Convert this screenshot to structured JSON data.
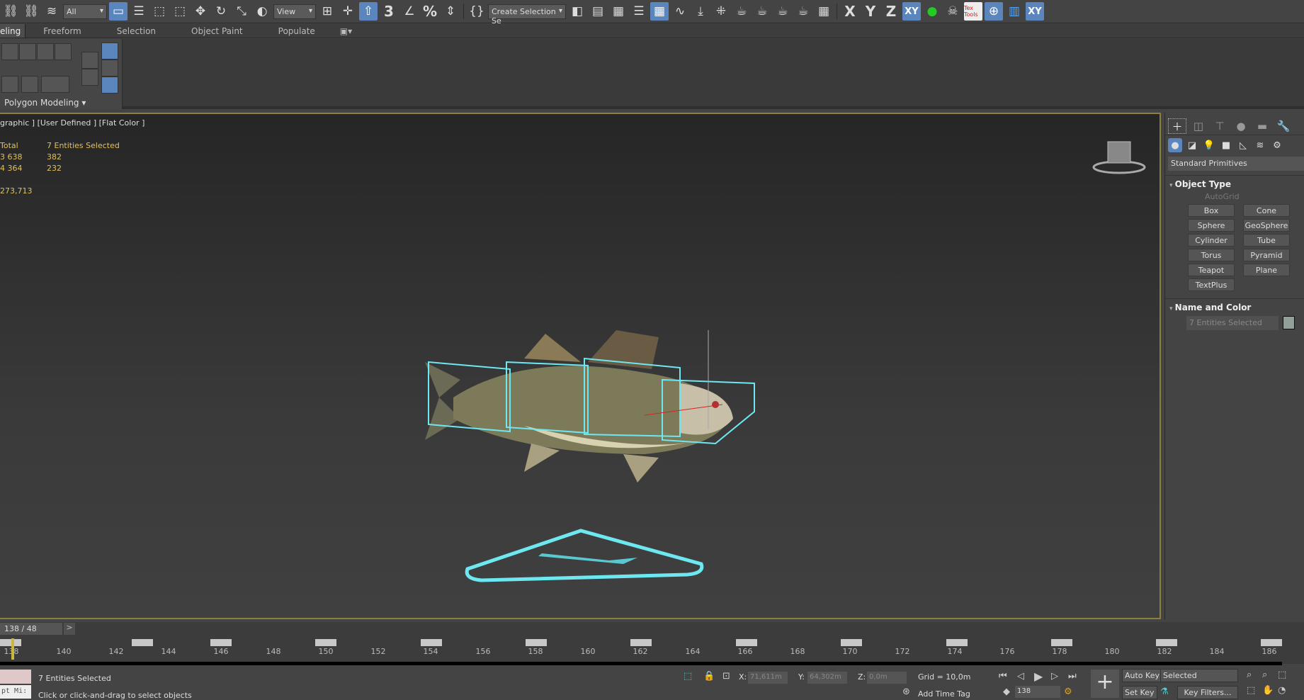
{
  "toolbar": {
    "selection_filter": "All",
    "ref_coord": "View",
    "named_selection": "Create Selection Se",
    "axis_x": "X",
    "axis_y": "Y",
    "axis_z": "Z",
    "axis_xy": "XY",
    "tex_tools": "Tex Tools",
    "xy_mod": "XY"
  },
  "ribbon": {
    "tabs": [
      "eling",
      "Freeform",
      "Selection",
      "Object Paint",
      "Populate"
    ],
    "panel_label": "Polygon Modeling"
  },
  "viewport": {
    "label": "graphic ] [User Defined ] [Flat Color ]",
    "stats": {
      "col1": [
        "Total",
        "3 638",
        "4 364",
        "",
        "273,713"
      ],
      "col2": [
        "7 Entities Selected",
        "382",
        "232"
      ]
    },
    "accent": "#8f7f3f",
    "selection_color": "#6ee8f0"
  },
  "command_panel": {
    "category": "Standard Primitives",
    "object_type_title": "Object Type",
    "autogrid": "AutoGrid",
    "buttons": [
      "Box",
      "Cone",
      "Sphere",
      "GeoSphere",
      "Cylinder",
      "Tube",
      "Torus",
      "Pyramid",
      "Teapot",
      "Plane",
      "TextPlus"
    ],
    "name_color_title": "Name and Color",
    "name_value": "7 Entities Selected",
    "object_color": "#93a09a"
  },
  "timeslider": {
    "frame": "138 / 48",
    "next": ">"
  },
  "trackbar": {
    "ticks": [
      "138",
      "140",
      "142",
      "144",
      "146",
      "148",
      "150",
      "152",
      "154",
      "156",
      "158",
      "160",
      "162",
      "164",
      "166",
      "168",
      "170",
      "172",
      "174",
      "176",
      "178",
      "180",
      "182",
      "184",
      "186"
    ]
  },
  "status": {
    "selection": "7 Entities Selected",
    "prompt": "Click or click-and-drag to select objects",
    "script": "pt Mi:",
    "x_label": "X:",
    "x": "71,611m",
    "y_label": "Y:",
    "y": "64,302m",
    "z_label": "Z:",
    "z": "0,0m",
    "grid": "Grid = 10,0m",
    "add_time_tag": "Add Time Tag",
    "current_frame": "138",
    "auto_key": "Auto Key",
    "set_key": "Set Key",
    "key_mode": "Selected",
    "key_filters": "Key Filters..."
  }
}
